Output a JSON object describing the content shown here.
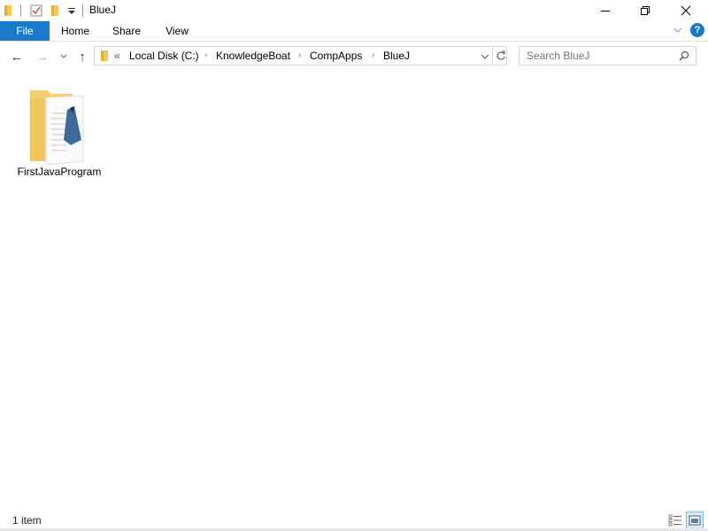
{
  "window": {
    "title": "BlueJ",
    "quick_access_icons": [
      "folder-icon",
      "properties-check-icon",
      "new-folder-icon",
      "customize-dropdown-icon"
    ],
    "controls": [
      "minimize-icon",
      "restore-icon",
      "close-icon"
    ]
  },
  "ribbon": {
    "tabs": [
      {
        "label": "File",
        "active": true
      },
      {
        "label": "Home"
      },
      {
        "label": "Share"
      },
      {
        "label": "View"
      }
    ],
    "accent_color": "#1979ca",
    "help_icon": "?"
  },
  "navigation": {
    "back_icon": "←",
    "forward_icon": "→",
    "recent_icon": "⌄",
    "up_icon": "↑",
    "overflow": "«",
    "breadcrumb": [
      "Local Disk (C:)",
      "KnowledgeBoat",
      "CompApps",
      "BlueJ"
    ],
    "separator": "›"
  },
  "search": {
    "placeholder": "Search BlueJ",
    "value": ""
  },
  "items": [
    {
      "name": "FirstJavaProgram",
      "type": "folder"
    }
  ],
  "status": {
    "item_count": "1 item"
  }
}
